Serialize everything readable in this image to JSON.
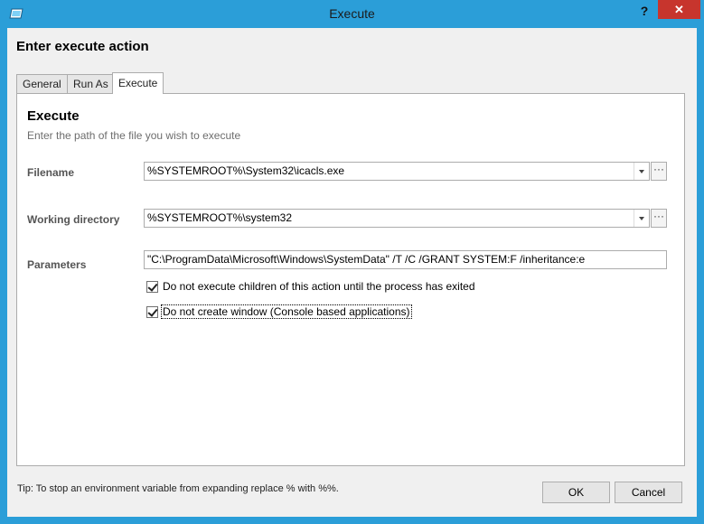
{
  "window": {
    "title": "Execute",
    "help_label": "?",
    "close_label": "✕",
    "icon": "app-window-icon"
  },
  "dialog": {
    "heading": "Enter execute action"
  },
  "tabs": [
    {
      "label": "General",
      "active": false
    },
    {
      "label": "Run As",
      "active": false
    },
    {
      "label": "Execute",
      "active": true
    }
  ],
  "panel": {
    "title": "Execute",
    "description": "Enter the path of the file you wish to execute",
    "filename": {
      "label": "Filename",
      "value": "%SYSTEMROOT%\\System32\\icacls.exe",
      "browse_label": "···"
    },
    "working_directory": {
      "label": "Working directory",
      "value": "%SYSTEMROOT%\\system32",
      "browse_label": "···"
    },
    "parameters": {
      "label": "Parameters",
      "value": "\"C:\\ProgramData\\Microsoft\\Windows\\SystemData\" /T /C /GRANT SYSTEM:F /inheritance:e"
    },
    "options": [
      {
        "label": "Do not execute children of this action until the process has exited",
        "checked": true
      },
      {
        "label": "Do not create window (Console based applications)",
        "checked": true
      }
    ]
  },
  "footer": {
    "tip": "Tip: To stop an environment variable from expanding replace % with %%.",
    "ok_label": "OK",
    "cancel_label": "Cancel"
  },
  "colors": {
    "title_bar": "#2b9ed8",
    "close_button": "#c7352d",
    "client_background": "#f0f0f0"
  }
}
